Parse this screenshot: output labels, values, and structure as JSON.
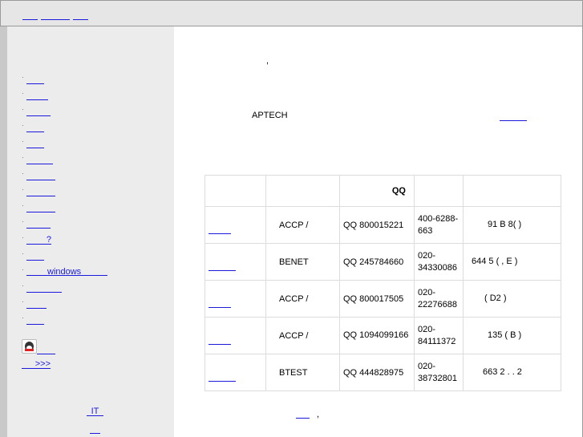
{
  "top_nav": [
    {
      "label": ""
    },
    {
      "label": ""
    },
    {
      "label": ""
    }
  ],
  "sidebar": {
    "menu": [
      {
        "label": ""
      },
      {
        "label": ""
      },
      {
        "label": ""
      },
      {
        "label": ""
      },
      {
        "label": ""
      },
      {
        "label": ""
      },
      {
        "label": ""
      },
      {
        "label": ""
      },
      {
        "label": ""
      },
      {
        "label": ""
      },
      {
        "label": "?"
      },
      {
        "label": ""
      },
      {
        "label": "windows"
      },
      {
        "label": ""
      },
      {
        "label": ""
      },
      {
        "label": ""
      }
    ],
    "more_link": ">>>",
    "it_link": "IT",
    "bottom_link": ""
  },
  "main": {
    "intro_comma": ",",
    "brand": "APTECH",
    "table": {
      "headers": [
        "",
        "",
        "QQ",
        "",
        ""
      ],
      "rows": [
        {
          "name": "",
          "course": "ACCP /",
          "qq": "QQ 800015221",
          "phone": "400-6288-663",
          "address": "91 B 8( )"
        },
        {
          "name": "",
          "course": "BENET",
          "qq": "QQ 245784660",
          "phone": "020-34330086",
          "address": "644 5 ( , E )"
        },
        {
          "name": "",
          "course": "ACCP /",
          "qq": "QQ 800017505",
          "phone": "020-22276688",
          "address": "( D2 )"
        },
        {
          "name": "",
          "course": "ACCP /",
          "qq": "QQ 1094099166",
          "phone": "020-84111372",
          "address": "135 ( B )"
        },
        {
          "name": "",
          "course": "BTEST",
          "qq": "QQ 444828975",
          "phone": "020-38732801",
          "address": "663 2 . . 2"
        }
      ]
    },
    "footer_comma": ","
  },
  "colors": {
    "link": "#1a1adf",
    "topbar_bg": "#e6e6e6",
    "sidebar_bg": "#ececec",
    "table_border": "#dcdcdc"
  }
}
